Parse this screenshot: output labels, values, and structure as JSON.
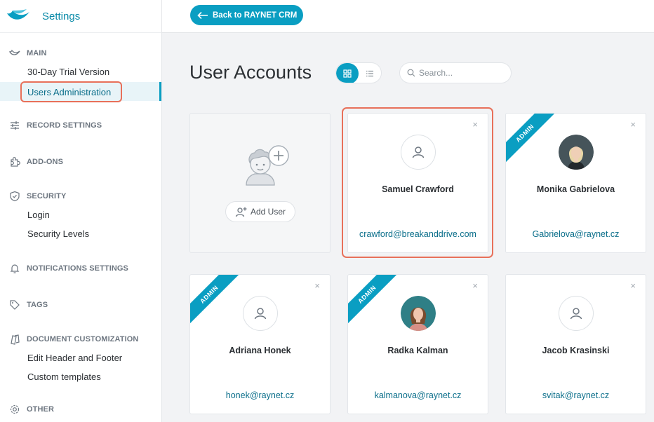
{
  "app": {
    "title": "Settings"
  },
  "sidebar": {
    "main": {
      "title": "MAIN",
      "items": [
        "30-Day Trial Version",
        "Users Administration"
      ]
    },
    "record_settings": "RECORD SETTINGS",
    "add_ons": "ADD-ONS",
    "security": {
      "title": "SECURITY",
      "items": [
        "Login",
        "Security Levels"
      ]
    },
    "notifications": "NOTIFICATIONS SETTINGS",
    "tags": "TAGS",
    "document_customization": {
      "title": "DOCUMENT CUSTOMIZATION",
      "items": [
        "Edit Header and Footer",
        "Custom templates"
      ]
    },
    "other": "OTHER"
  },
  "header": {
    "back_label": "Back to RAYNET CRM"
  },
  "main": {
    "title": "User Accounts",
    "search_placeholder": "Search...",
    "add_user_label": "Add User",
    "users": [
      {
        "name": "Samuel Crawford",
        "email": "crawford@breakanddrive.com",
        "admin": false,
        "photo": false
      },
      {
        "name": "Monika Gabrielova",
        "email": "Gabrielova@raynet.cz",
        "admin": true,
        "photo": true
      },
      {
        "name": "Adriana Honek",
        "email": "honek@raynet.cz",
        "admin": true,
        "photo": false
      },
      {
        "name": "Radka Kalman",
        "email": "kalmanova@raynet.cz",
        "admin": true,
        "photo": true
      },
      {
        "name": "Jacob Krasinski",
        "email": "svitak@raynet.cz",
        "admin": false,
        "photo": false
      }
    ],
    "admin_badge": "ADMIN",
    "close_glyph": "×"
  },
  "colors": {
    "accent": "#0a9ec2",
    "highlight": "#e8705a",
    "link": "#0a6e8a"
  }
}
